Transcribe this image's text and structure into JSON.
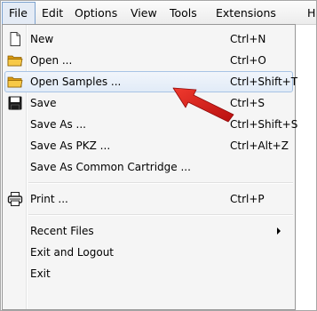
{
  "menubar": {
    "items": [
      {
        "label": "File",
        "active": true
      },
      {
        "label": "Edit"
      },
      {
        "label": "Options"
      },
      {
        "label": "View"
      },
      {
        "label": "Tools"
      },
      {
        "label": "Extensions"
      },
      {
        "label": "H"
      }
    ]
  },
  "file_menu": {
    "items": [
      {
        "label": "New",
        "shortcut": "Ctrl+N",
        "icon": "new-document-icon"
      },
      {
        "label": "Open ...",
        "shortcut": "Ctrl+O",
        "icon": "folder-icon"
      },
      {
        "label": "Open Samples ...",
        "shortcut": "Ctrl+Shift+T",
        "icon": "folder-icon",
        "highlighted": true
      },
      {
        "label": "Save",
        "shortcut": "Ctrl+S",
        "icon": "floppy-disk-icon"
      },
      {
        "label": "Save As ...",
        "shortcut": "Ctrl+Shift+S"
      },
      {
        "label": "Save As PKZ ...",
        "shortcut": "Ctrl+Alt+Z"
      },
      {
        "label": "Save As Common Cartridge ...",
        "shortcut": ""
      },
      {
        "label": "Print ...",
        "shortcut": "Ctrl+P",
        "icon": "printer-icon"
      },
      {
        "label": "Recent Files",
        "shortcut": "",
        "submenu": true
      },
      {
        "label": "Exit and Logout",
        "shortcut": ""
      },
      {
        "label": "Exit",
        "shortcut": ""
      }
    ]
  },
  "annotation": {
    "arrow_color": "#e01b1b",
    "arrow_icon": "red-arrow-icon"
  },
  "colors": {
    "highlight_border": "#a8c4e5",
    "highlight_fill": "#e1ebf7",
    "menu_background": "#f5f5f5",
    "active_menubar_border": "#7da2ce"
  }
}
